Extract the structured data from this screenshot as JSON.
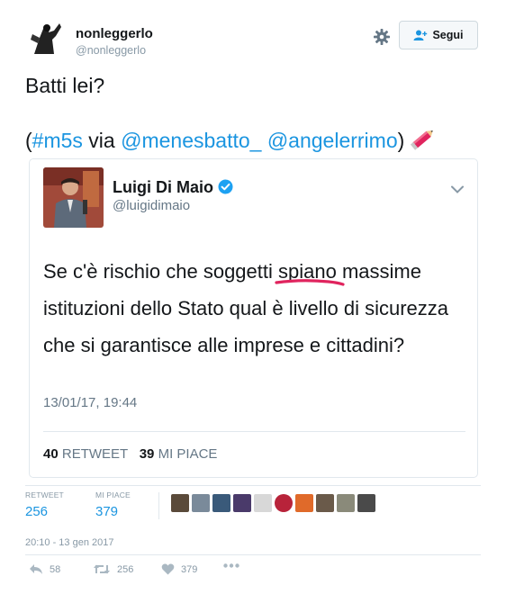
{
  "author": {
    "name": "nonleggerlo",
    "handle": "@nonleggerlo",
    "follow_label": "Segui"
  },
  "tweet": {
    "line1": "Batti lei?",
    "open_paren": "(",
    "hashtag": "#m5s",
    "via": " via ",
    "mention1": "@menesbatto_",
    "space": " ",
    "mention2": "@angelerrimo",
    "close_paren": ")"
  },
  "quoted": {
    "name": "Luigi Di Maio",
    "handle": "@luigidimaio",
    "text_before": "Se c'è rischio che soggetti ",
    "text_underlined": "spiano",
    "text_after": " massime istituzioni dello Stato qual è livello di sicurezza che si garantisce alle imprese e cittadini?",
    "timestamp": "13/01/17, 19:44",
    "retweet_count": "40",
    "retweet_label": "RETWEET",
    "like_count": "39",
    "like_label": "MI PIACE"
  },
  "stats": {
    "retweet_label": "RETWEET",
    "retweet_value": "256",
    "like_label": "MI PIACE",
    "like_value": "379"
  },
  "timestamp": "20:10 - 13 gen 2017",
  "actions": {
    "reply_count": "58",
    "retweet_count": "256",
    "like_count": "379"
  },
  "colors": {
    "link": "#1b95e0",
    "highlight_stroke": "#e0245e",
    "verified": "#1da1f2"
  }
}
